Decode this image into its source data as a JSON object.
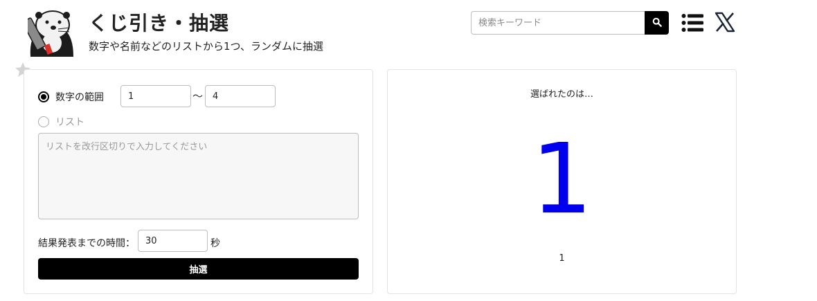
{
  "header": {
    "title": "くじ引き・抽選",
    "subtitle": "数字や名前などのリストから1つ、ランダムに抽選",
    "logo_icon": "sea-otter-mascot-icon",
    "favorite_icon": "star-icon"
  },
  "search": {
    "placeholder": "検索キーワード",
    "value": "",
    "button_icon": "search-icon"
  },
  "nav": {
    "menu_icon": "list-menu-icon",
    "social_icon": "x-logo-icon"
  },
  "form": {
    "mode_range_label": "数字の範囲",
    "mode_range_selected": true,
    "range_from": "1",
    "range_separator": "〜",
    "range_to": "4",
    "mode_list_label": "リスト",
    "mode_list_selected": false,
    "list_placeholder": "リストを改行区切りで入力してください",
    "list_value": "",
    "time_label": "結果発表までの時間：",
    "time_value": "30",
    "time_unit": "秒",
    "draw_button_label": "抽選"
  },
  "result": {
    "heading": "選ばれたのは…",
    "value_large": "1",
    "value_small": "1",
    "value_color": "#0000ee"
  },
  "colors": {
    "button_bg": "#000000",
    "border": "#e3e3e3"
  }
}
